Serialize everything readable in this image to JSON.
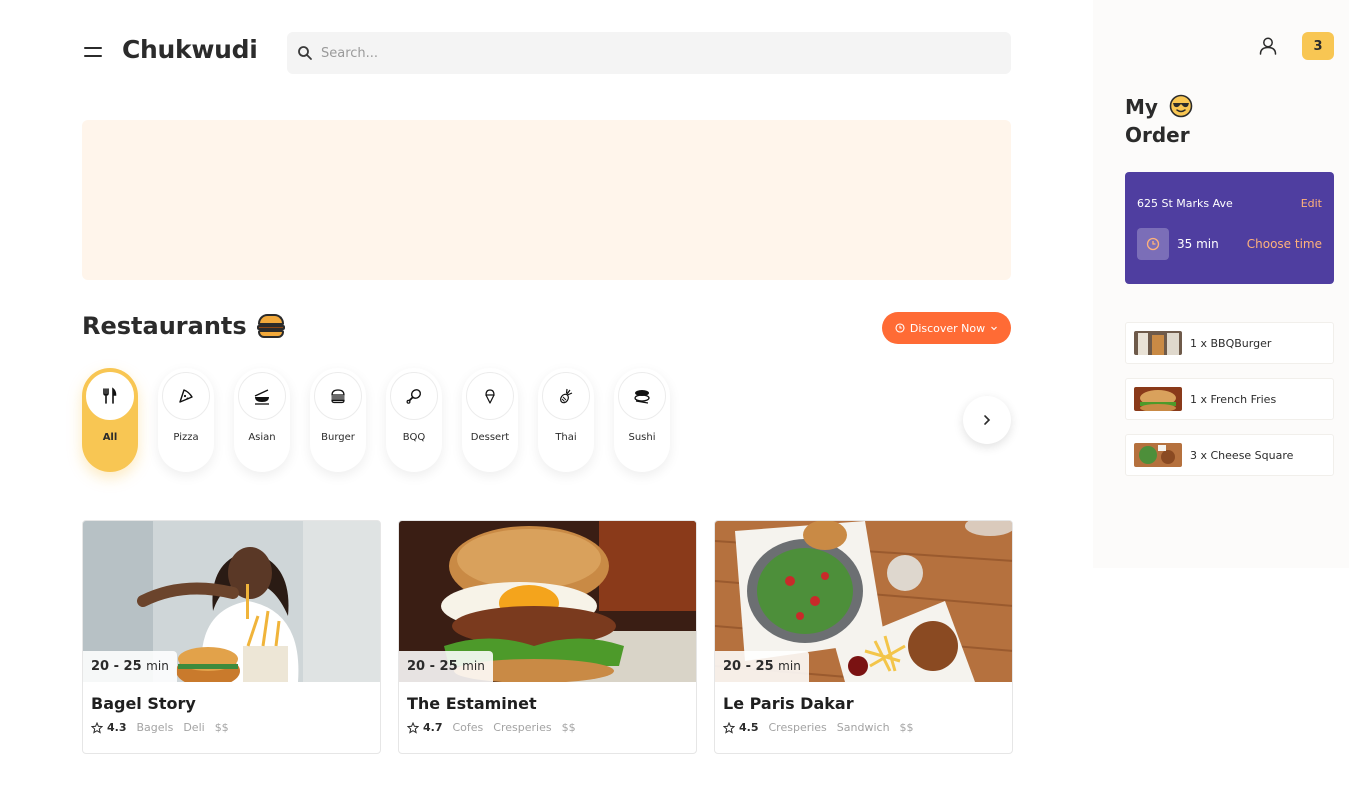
{
  "header": {
    "brand": "Chukwudi",
    "search_placeholder": "Search..."
  },
  "restaurants_section": {
    "title": "Restaurants",
    "title_icon": "burger-emoji",
    "discover_label": "Discover Now"
  },
  "categories": [
    {
      "label": "All",
      "icon": "cutlery-icon",
      "active": true
    },
    {
      "label": "Pizza",
      "icon": "pizza-icon",
      "active": false
    },
    {
      "label": "Asian",
      "icon": "asian-icon",
      "active": false
    },
    {
      "label": "Burger",
      "icon": "burger-icon",
      "active": false
    },
    {
      "label": "BQQ",
      "icon": "drumstick-icon",
      "active": false
    },
    {
      "label": "Dessert",
      "icon": "ice-cream-icon",
      "active": false
    },
    {
      "label": "Thai",
      "icon": "pineapple-icon",
      "active": false
    },
    {
      "label": "Sushi",
      "icon": "sushi-icon",
      "active": false
    }
  ],
  "restaurants": [
    {
      "name": "Bagel Story",
      "time": "20 - 25",
      "time_unit": "min",
      "rating": "4.3",
      "tags": [
        "Bagels",
        "Deli",
        "$$"
      ]
    },
    {
      "name": "The Estaminet",
      "time": "20 - 25",
      "time_unit": "min",
      "rating": "4.7",
      "tags": [
        "Cofes",
        "Cresperies",
        "$$"
      ]
    },
    {
      "name": "Le Paris Dakar",
      "time": "20 - 25",
      "time_unit": "min",
      "rating": "4.5",
      "tags": [
        "Cresperies",
        "Sandwich",
        "$$"
      ]
    }
  ],
  "sidebar": {
    "cart_count": "3",
    "order_title_line1": "My",
    "order_title_line2": "Order",
    "title_icon": "cool-face-emoji",
    "address": "625 St Marks Ave",
    "edit_label": "Edit",
    "eta": "35 min",
    "choose_time_label": "Choose time",
    "items": [
      {
        "label": "1 x BBQBurger"
      },
      {
        "label": "1 x French Fries"
      },
      {
        "label": "3 x Cheese Square"
      }
    ]
  },
  "colors": {
    "accent_yellow": "#f8c653",
    "accent_orange": "#ff6b35",
    "purple": "#4f3ea0",
    "banner": "#fff5eb"
  }
}
